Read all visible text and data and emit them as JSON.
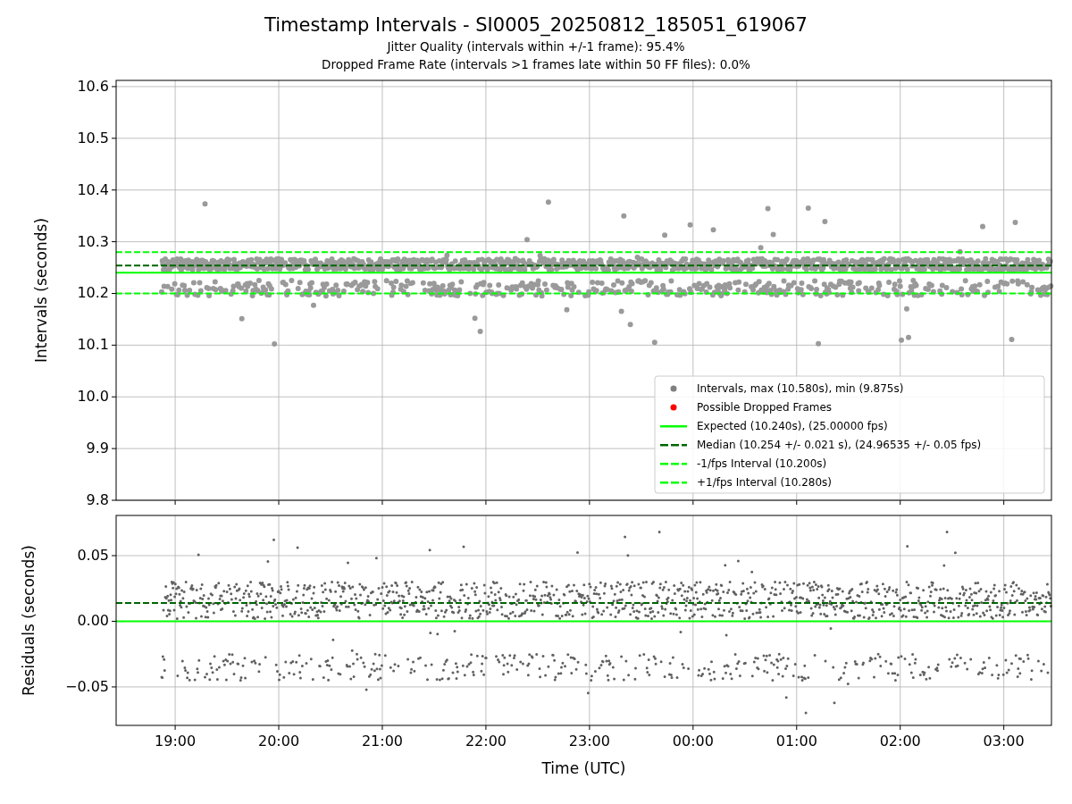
{
  "figure": {
    "title": "Timestamp Intervals - SI0005_20250812_185051_619067",
    "subtitle_lines": [
      "Jitter Quality (intervals within +/-1 frame): 95.4%",
      "Dropped Frame Rate (intervals >1 frames late within 50 FF files): 0.0%"
    ]
  },
  "intervals_panel": {
    "chart_data": {
      "type": "scatter",
      "ylabel": "Intervals (seconds)",
      "grid": true,
      "categories": [
        null,
        null,
        null,
        null,
        null,
        null,
        null,
        null,
        null
      ],
      "ylim": [
        9.8,
        10.612
      ],
      "yticks": [
        {
          "value": 9.8,
          "label": "9.8"
        },
        {
          "value": 9.9,
          "label": "9.9"
        },
        {
          "value": 10.0,
          "label": "10.0"
        },
        {
          "value": 10.1,
          "label": "10.1"
        },
        {
          "value": 10.2,
          "label": "10.2"
        },
        {
          "value": 10.3,
          "label": "10.3"
        },
        {
          "value": 10.4,
          "label": "10.4"
        },
        {
          "value": 10.5,
          "label": "10.5"
        },
        {
          "value": 10.6,
          "label": "10.6"
        }
      ],
      "ref_lines": [
        {
          "axis": "y",
          "value": 10.24,
          "color": "#00ff00",
          "line_style": "solid"
        },
        {
          "axis": "y",
          "value": 10.254,
          "color": "#006400",
          "line_style": "dashed"
        },
        {
          "axis": "y",
          "value": 10.2,
          "color": "#00ff00",
          "line_style": "dashed"
        },
        {
          "axis": "y",
          "value": 10.28,
          "color": "#00ff00",
          "line_style": "dashed"
        }
      ]
    },
    "legend": [
      {
        "label": "Intervals, max (10.580s), min (9.875s)",
        "kind": "marker",
        "color": "#808080"
      },
      {
        "label": "Possible Dropped Frames",
        "kind": "marker",
        "color": "#ff0000"
      },
      {
        "label": "Expected (10.240s), (25.00000 fps)",
        "kind": "solid",
        "color": "#00ff00"
      },
      {
        "label": "Median (10.254 +/- 0.021 s), (24.96535 +/- 0.05 fps)",
        "kind": "dashed",
        "color": "#006400"
      },
      {
        "label": "-1/fps Interval (10.200s)",
        "kind": "dashed",
        "color": "#00ff00"
      },
      {
        "label": "+1/fps Interval (10.280s)",
        "kind": "dashed",
        "color": "#00ff00"
      }
    ]
  },
  "residuals_panel": {
    "chart_data": {
      "type": "scatter",
      "xlabel": "Time (UTC)",
      "ylabel": "Residuals (seconds)",
      "grid": true,
      "categories": [
        "19:00",
        "20:00",
        "21:00",
        "22:00",
        "23:00",
        "00:00",
        "01:00",
        "02:00",
        "03:00"
      ],
      "ylim": [
        -0.0793,
        0.0806
      ],
      "yticks": [
        {
          "value": -0.05,
          "label": "−0.05"
        },
        {
          "value": 0,
          "label": "0.00"
        },
        {
          "value": 0.05,
          "label": "0.05"
        }
      ],
      "ref_lines": [
        {
          "axis": "y",
          "value": 0,
          "color": "#00ff00",
          "line_style": "solid"
        },
        {
          "axis": "y",
          "value": 0.014,
          "color": "#006400",
          "line_style": "dashed"
        }
      ]
    }
  }
}
